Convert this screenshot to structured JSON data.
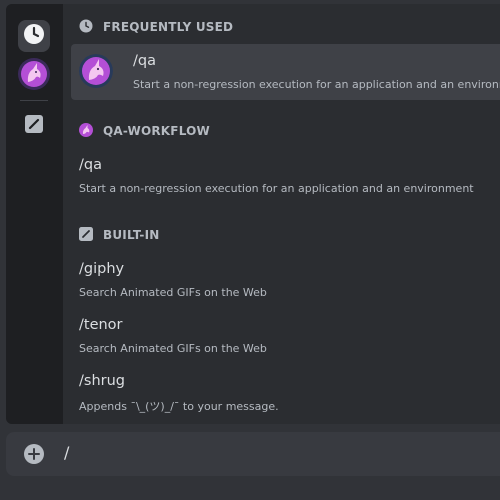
{
  "rail": {
    "items": [
      {
        "icon": "clock-icon",
        "active": true
      },
      {
        "icon": "qa-workflow-bot-avatar",
        "active": false
      },
      {
        "icon": "built-in-slash-icon",
        "active": false
      }
    ]
  },
  "sections": {
    "frequently_used": {
      "title": "FREQUENTLY USED",
      "icon": "clock-icon",
      "commands": [
        {
          "name": "/qa",
          "description": "Start a non-regression execution for an application and an environment"
        }
      ]
    },
    "qa_workflow": {
      "title": "QA-WORKFLOW",
      "icon": "qa-workflow-bot-avatar",
      "commands": [
        {
          "name": "/qa",
          "description": "Start a non-regression execution for an application and an environment"
        }
      ]
    },
    "built_in": {
      "title": "BUILT-IN",
      "icon": "built-in-slash-icon",
      "commands": [
        {
          "name": "/giphy",
          "description": "Search Animated GIFs on the Web"
        },
        {
          "name": "/tenor",
          "description": "Search Animated GIFs on the Web"
        },
        {
          "name": "/shrug",
          "description": "Appends ¯\\_(ツ)_/¯ to your message."
        }
      ]
    }
  },
  "chat_input": {
    "value": "/"
  },
  "colors": {
    "accent_avatar": "#b44fd6",
    "selected_row": "#3f4147",
    "rail_bg": "#1e1f22"
  }
}
